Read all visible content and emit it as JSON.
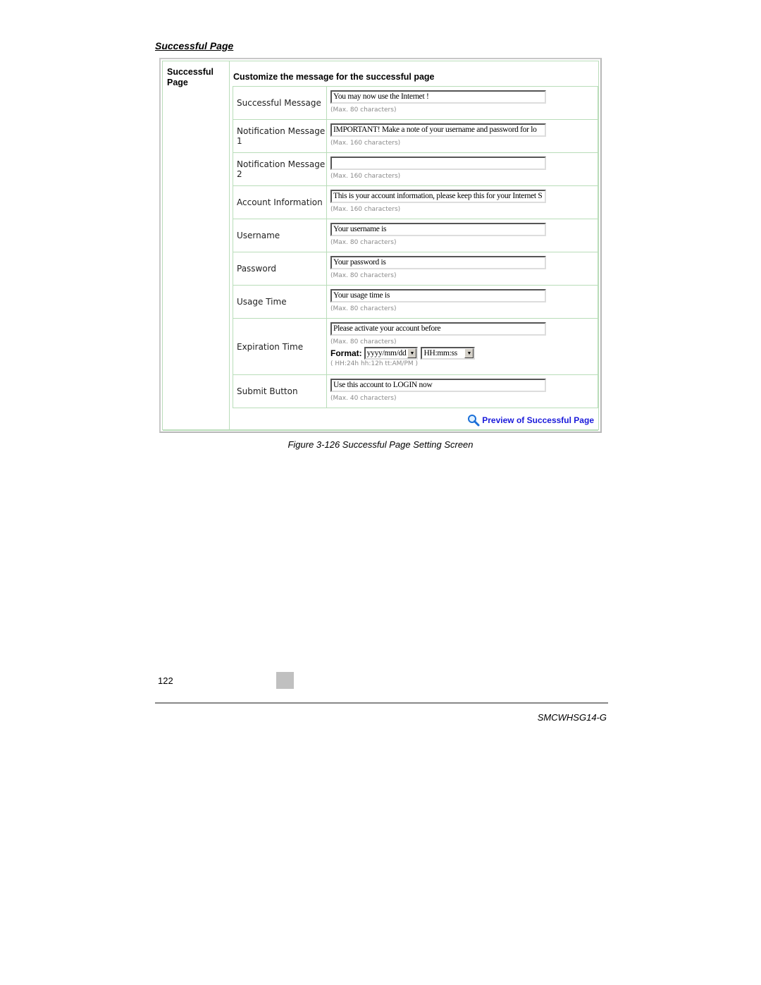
{
  "document": {
    "section_heading": "Successful Page",
    "caption": "Figure 3-126 Successful Page Setting Screen",
    "page_number": "122",
    "model": "SMCWHSG14-G"
  },
  "screen": {
    "side_title": "Successful Page",
    "main_title": "Customize the message for the successful page",
    "rows": [
      {
        "label": "Successful Message",
        "value": "You may now use the Internet !",
        "hint": "(Max. 80 characters)"
      },
      {
        "label": "Notification Message 1",
        "value": "IMPORTANT! Make a note of your username and password for lo",
        "hint": "(Max. 160 characters)"
      },
      {
        "label": "Notification Message 2",
        "value": "",
        "hint": "(Max. 160 characters)"
      },
      {
        "label": "Account Information",
        "value": "This is your account information, please keep this for your Internet S",
        "hint": "(Max. 160 characters)"
      },
      {
        "label": "Username",
        "value": "Your username is",
        "hint": "(Max. 80 characters)"
      },
      {
        "label": "Password",
        "value": "Your password is",
        "hint": "(Max. 80 characters)"
      },
      {
        "label": "Usage Time",
        "value": "Your usage time is",
        "hint": "(Max. 80 characters)"
      },
      {
        "label": "Expiration Time",
        "value": "Please activate your account before",
        "hint": "(Max. 80 characters)"
      },
      {
        "label": "Submit Button",
        "value": "Use this account to LOGIN now",
        "hint": "(Max. 40 characters)"
      }
    ],
    "format": {
      "label": "Format:",
      "date_selected": "yyyy/mm/dd",
      "time_selected": "HH:mm:ss",
      "hint": "( HH:24h hh:12h tt:AM/PM )"
    },
    "preview_link": "Preview of Successful Page",
    "colors": {
      "link": "#1a1adb",
      "grid": "#b9ddb9",
      "hint": "#8a8a8a"
    }
  }
}
